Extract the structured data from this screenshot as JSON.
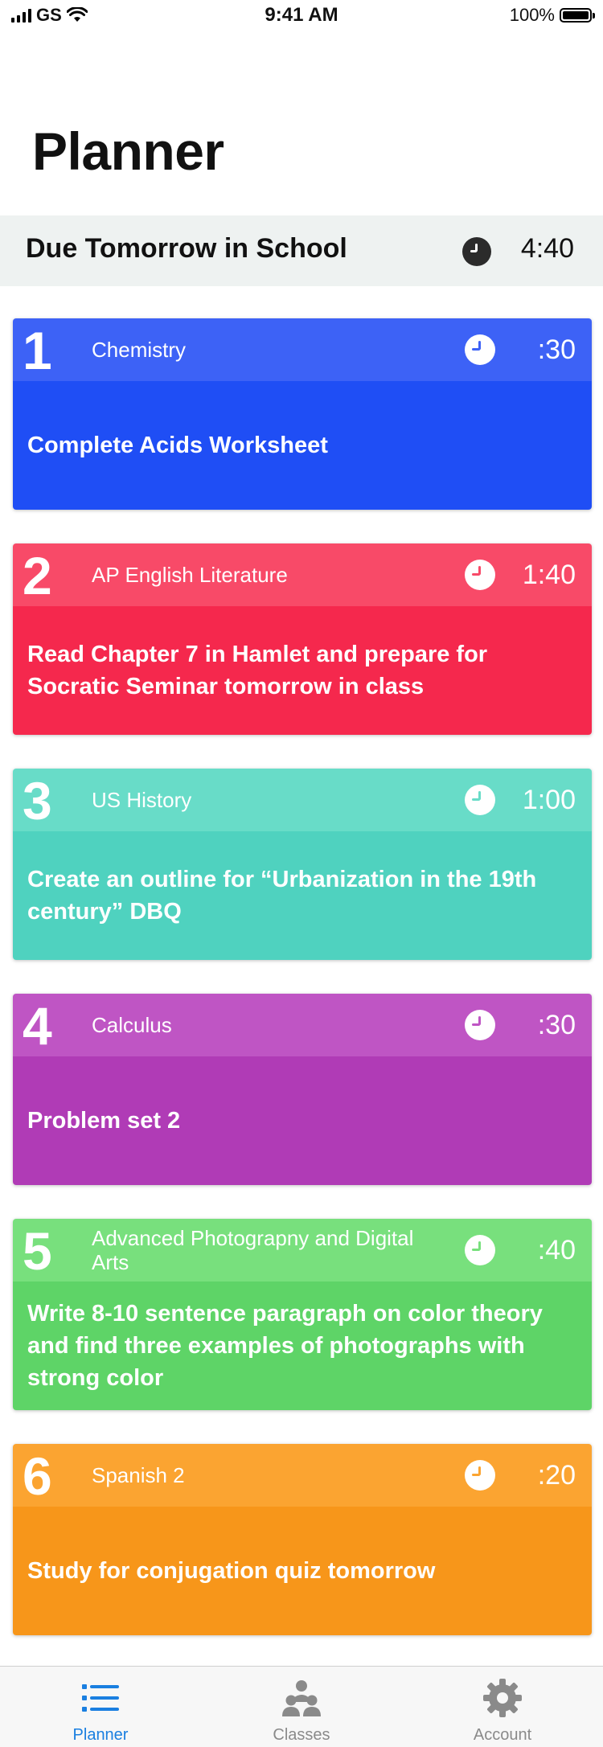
{
  "status": {
    "carrier": "GS",
    "time": "9:41 AM",
    "battery": "100%"
  },
  "page_title": "Planner",
  "due": {
    "title": "Due Tomorrow in School",
    "time": "4:40"
  },
  "cards": [
    {
      "num": "1",
      "subject": "Chemistry",
      "time": ":30",
      "task": "Complete Acids Worksheet",
      "head": "#3d62f6",
      "body": "#1f4ef5",
      "hand": "#3d62f6"
    },
    {
      "num": "2",
      "subject": "AP English Literature",
      "time": "1:40",
      "task": "Read Chapter 7 in Hamlet and prepare for Socratic Seminar tomorrow in class",
      "head": "#f84a68",
      "body": "#f5284d",
      "hand": "#f84a68"
    },
    {
      "num": "3",
      "subject": "US History",
      "time": "1:00",
      "task": "Create an outline for  “Urbanization in the 19th century” DBQ",
      "head": "#68dcc8",
      "body": "#4fd2bf",
      "hand": "#68dcc8"
    },
    {
      "num": "4",
      "subject": "Calculus",
      "time": ":30",
      "task": "Problem set 2",
      "head": "#bf55c4",
      "body": "#b03bb6",
      "hand": "#bf55c4"
    },
    {
      "num": "5",
      "subject": "Advanced Photograpny and Digital Arts",
      "time": ":40",
      "task": "Write 8-10 sentence paragraph on color theory and find three examples of photographs with strong color",
      "head": "#78e07d",
      "body": "#5ed467",
      "hand": "#78e07d"
    },
    {
      "num": "6",
      "subject": "Spanish 2",
      "time": ":20",
      "task": "Study for conjugation quiz tomorrow",
      "head": "#fba431",
      "body": "#f7961a",
      "hand": "#fba431"
    }
  ],
  "tabs": [
    {
      "label": "Planner",
      "icon": "list-icon"
    },
    {
      "label": "Classes",
      "icon": "people-icon"
    },
    {
      "label": "Account",
      "icon": "gear-icon"
    }
  ],
  "colors": {
    "accent": "#1a7fe0",
    "inactive": "#8a8a8a"
  }
}
